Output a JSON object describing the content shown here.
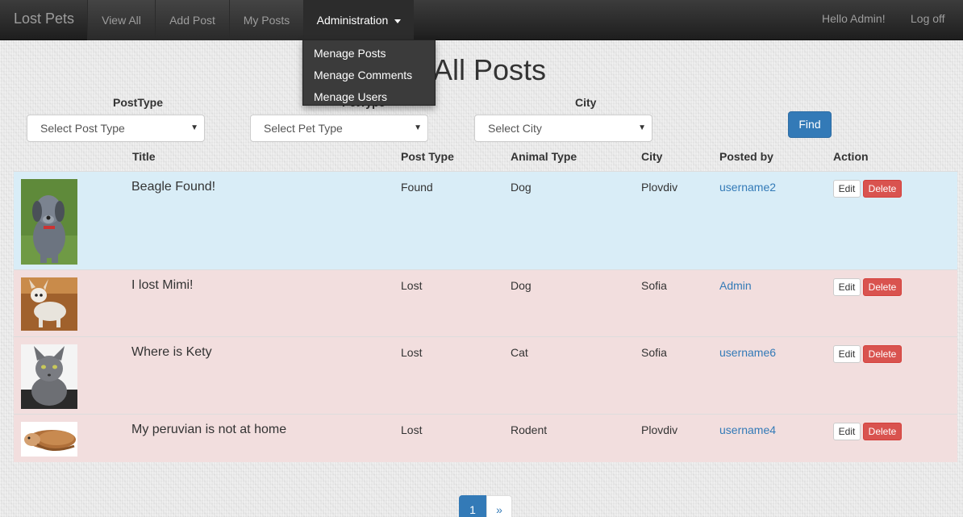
{
  "navbar": {
    "brand": "Lost Pets",
    "items": [
      {
        "label": "View All"
      },
      {
        "label": "Add Post"
      },
      {
        "label": "My Posts"
      },
      {
        "label": "Administration"
      }
    ],
    "greeting": "Hello Admin!",
    "logoff": "Log off"
  },
  "admin_menu": {
    "items": [
      {
        "label": "Menage Posts"
      },
      {
        "label": "Menage Comments"
      },
      {
        "label": "Menage Users"
      }
    ]
  },
  "page": {
    "title": "All Posts"
  },
  "filters": {
    "post_type": {
      "label": "PostType",
      "value": "Select Post Type"
    },
    "pet_type": {
      "label": "PetType",
      "value": "Select Pet Type"
    },
    "city": {
      "label": "City",
      "value": "Select City"
    },
    "find_label": "Find"
  },
  "table": {
    "headers": [
      "Title",
      "Post Type",
      "Animal Type",
      "City",
      "Posted by",
      "Action"
    ],
    "edit_label": "Edit",
    "delete_label": "Delete",
    "rows": [
      {
        "title": "Beagle Found!",
        "post_type": "Found",
        "animal": "Dog",
        "city": "Plovdiv",
        "posted_by": "username2",
        "thumb": "grey-puppy-photo"
      },
      {
        "title": "I lost Mimi!",
        "post_type": "Lost",
        "animal": "Dog",
        "city": "Sofia",
        "posted_by": "Admin",
        "thumb": "chihuahua-photo"
      },
      {
        "title": "Where is Kety",
        "post_type": "Lost",
        "animal": "Cat",
        "city": "Sofia",
        "posted_by": "username6",
        "thumb": "grey-cat-photo"
      },
      {
        "title": "My peruvian is not at home",
        "post_type": "Lost",
        "animal": "Rodent",
        "city": "Plovdiv",
        "posted_by": "username4",
        "thumb": "guinea-pig-photo"
      }
    ]
  },
  "pagination": {
    "current": "1",
    "next": "»"
  }
}
